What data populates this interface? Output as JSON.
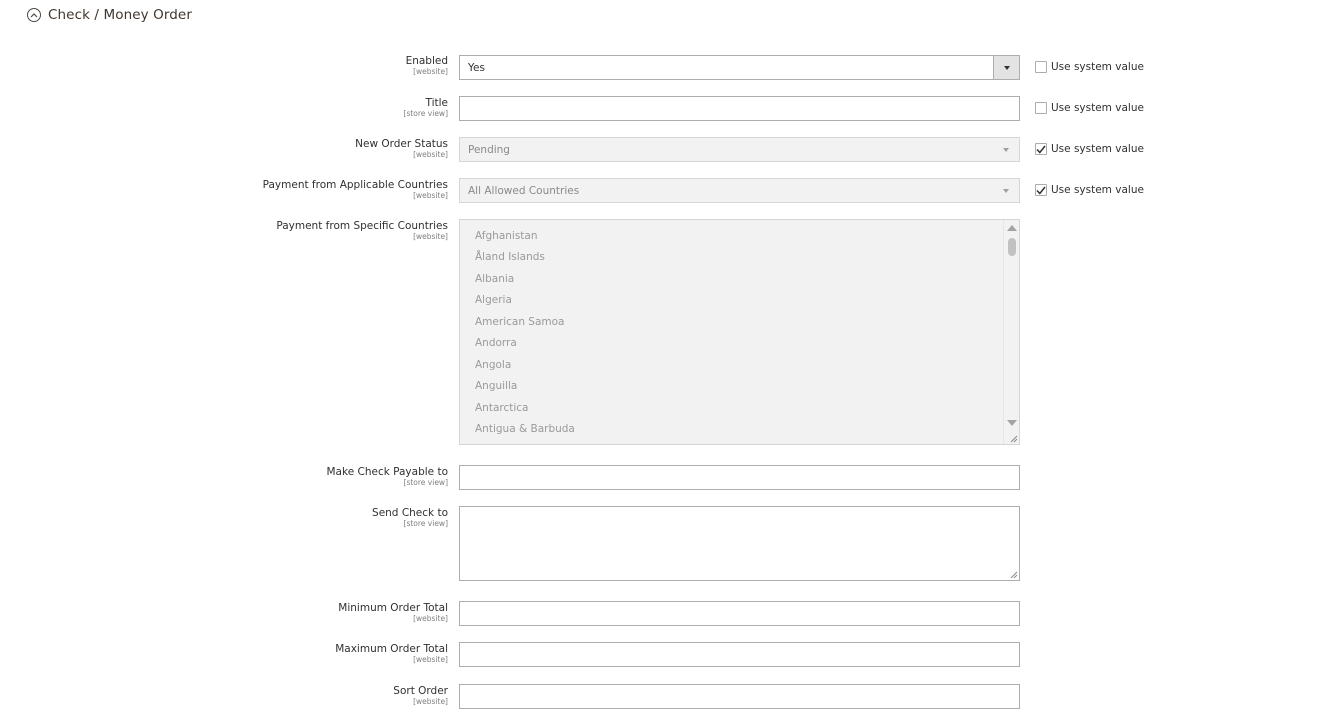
{
  "section": {
    "title": "Check / Money Order"
  },
  "system_value_label": "Use system value",
  "fields": {
    "enabled": {
      "label": "Enabled",
      "scope": "[website]",
      "value": "Yes"
    },
    "title": {
      "label": "Title",
      "scope": "[store view]",
      "value": ""
    },
    "new_order_status": {
      "label": "New Order Status",
      "scope": "[website]",
      "value": "Pending"
    },
    "applicable_countries": {
      "label": "Payment from Applicable Countries",
      "scope": "[website]",
      "value": "All Allowed Countries"
    },
    "specific_countries": {
      "label": "Payment from Specific Countries",
      "scope": "[website]",
      "options": [
        "Afghanistan",
        "Åland Islands",
        "Albania",
        "Algeria",
        "American Samoa",
        "Andorra",
        "Angola",
        "Anguilla",
        "Antarctica",
        "Antigua & Barbuda"
      ]
    },
    "payable_to": {
      "label": "Make Check Payable to",
      "scope": "[store view]",
      "value": ""
    },
    "send_check_to": {
      "label": "Send Check to",
      "scope": "[store view]",
      "value": ""
    },
    "min_order_total": {
      "label": "Minimum Order Total",
      "scope": "[website]",
      "value": ""
    },
    "max_order_total": {
      "label": "Maximum Order Total",
      "scope": "[website]",
      "value": ""
    },
    "sort_order": {
      "label": "Sort Order",
      "scope": "[website]",
      "value": ""
    }
  },
  "colors": {
    "border": "#adadad",
    "disabled_bg": "#f2f2f2",
    "text": "#303030"
  }
}
